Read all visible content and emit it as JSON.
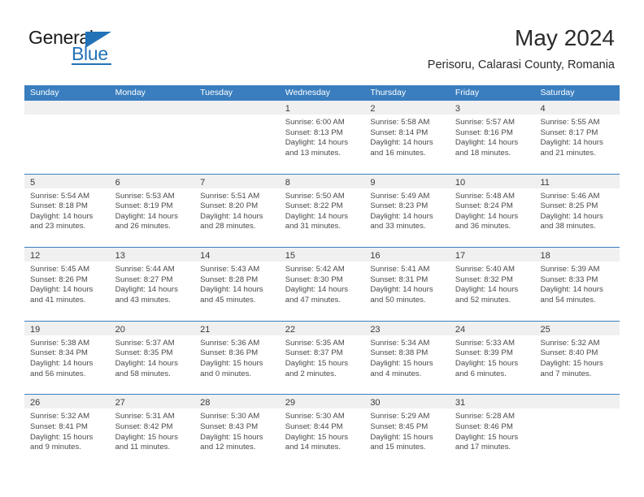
{
  "brand": {
    "name_part1": "General",
    "name_part2": "Blue",
    "accent_color": "#2272b8"
  },
  "header": {
    "month_year": "May 2024",
    "location": "Perisoru, Calarasi County, Romania"
  },
  "calendar": {
    "header_bg": "#3a7ebf",
    "day_band_bg": "#f0f0f0",
    "weekday_headers": [
      "Sunday",
      "Monday",
      "Tuesday",
      "Wednesday",
      "Thursday",
      "Friday",
      "Saturday"
    ],
    "weeks": [
      [
        {
          "day": "",
          "lines": []
        },
        {
          "day": "",
          "lines": []
        },
        {
          "day": "",
          "lines": []
        },
        {
          "day": "1",
          "lines": [
            "Sunrise: 6:00 AM",
            "Sunset: 8:13 PM",
            "Daylight: 14 hours",
            "and 13 minutes."
          ]
        },
        {
          "day": "2",
          "lines": [
            "Sunrise: 5:58 AM",
            "Sunset: 8:14 PM",
            "Daylight: 14 hours",
            "and 16 minutes."
          ]
        },
        {
          "day": "3",
          "lines": [
            "Sunrise: 5:57 AM",
            "Sunset: 8:16 PM",
            "Daylight: 14 hours",
            "and 18 minutes."
          ]
        },
        {
          "day": "4",
          "lines": [
            "Sunrise: 5:55 AM",
            "Sunset: 8:17 PM",
            "Daylight: 14 hours",
            "and 21 minutes."
          ]
        }
      ],
      [
        {
          "day": "5",
          "lines": [
            "Sunrise: 5:54 AM",
            "Sunset: 8:18 PM",
            "Daylight: 14 hours",
            "and 23 minutes."
          ]
        },
        {
          "day": "6",
          "lines": [
            "Sunrise: 5:53 AM",
            "Sunset: 8:19 PM",
            "Daylight: 14 hours",
            "and 26 minutes."
          ]
        },
        {
          "day": "7",
          "lines": [
            "Sunrise: 5:51 AM",
            "Sunset: 8:20 PM",
            "Daylight: 14 hours",
            "and 28 minutes."
          ]
        },
        {
          "day": "8",
          "lines": [
            "Sunrise: 5:50 AM",
            "Sunset: 8:22 PM",
            "Daylight: 14 hours",
            "and 31 minutes."
          ]
        },
        {
          "day": "9",
          "lines": [
            "Sunrise: 5:49 AM",
            "Sunset: 8:23 PM",
            "Daylight: 14 hours",
            "and 33 minutes."
          ]
        },
        {
          "day": "10",
          "lines": [
            "Sunrise: 5:48 AM",
            "Sunset: 8:24 PM",
            "Daylight: 14 hours",
            "and 36 minutes."
          ]
        },
        {
          "day": "11",
          "lines": [
            "Sunrise: 5:46 AM",
            "Sunset: 8:25 PM",
            "Daylight: 14 hours",
            "and 38 minutes."
          ]
        }
      ],
      [
        {
          "day": "12",
          "lines": [
            "Sunrise: 5:45 AM",
            "Sunset: 8:26 PM",
            "Daylight: 14 hours",
            "and 41 minutes."
          ]
        },
        {
          "day": "13",
          "lines": [
            "Sunrise: 5:44 AM",
            "Sunset: 8:27 PM",
            "Daylight: 14 hours",
            "and 43 minutes."
          ]
        },
        {
          "day": "14",
          "lines": [
            "Sunrise: 5:43 AM",
            "Sunset: 8:28 PM",
            "Daylight: 14 hours",
            "and 45 minutes."
          ]
        },
        {
          "day": "15",
          "lines": [
            "Sunrise: 5:42 AM",
            "Sunset: 8:30 PM",
            "Daylight: 14 hours",
            "and 47 minutes."
          ]
        },
        {
          "day": "16",
          "lines": [
            "Sunrise: 5:41 AM",
            "Sunset: 8:31 PM",
            "Daylight: 14 hours",
            "and 50 minutes."
          ]
        },
        {
          "day": "17",
          "lines": [
            "Sunrise: 5:40 AM",
            "Sunset: 8:32 PM",
            "Daylight: 14 hours",
            "and 52 minutes."
          ]
        },
        {
          "day": "18",
          "lines": [
            "Sunrise: 5:39 AM",
            "Sunset: 8:33 PM",
            "Daylight: 14 hours",
            "and 54 minutes."
          ]
        }
      ],
      [
        {
          "day": "19",
          "lines": [
            "Sunrise: 5:38 AM",
            "Sunset: 8:34 PM",
            "Daylight: 14 hours",
            "and 56 minutes."
          ]
        },
        {
          "day": "20",
          "lines": [
            "Sunrise: 5:37 AM",
            "Sunset: 8:35 PM",
            "Daylight: 14 hours",
            "and 58 minutes."
          ]
        },
        {
          "day": "21",
          "lines": [
            "Sunrise: 5:36 AM",
            "Sunset: 8:36 PM",
            "Daylight: 15 hours",
            "and 0 minutes."
          ]
        },
        {
          "day": "22",
          "lines": [
            "Sunrise: 5:35 AM",
            "Sunset: 8:37 PM",
            "Daylight: 15 hours",
            "and 2 minutes."
          ]
        },
        {
          "day": "23",
          "lines": [
            "Sunrise: 5:34 AM",
            "Sunset: 8:38 PM",
            "Daylight: 15 hours",
            "and 4 minutes."
          ]
        },
        {
          "day": "24",
          "lines": [
            "Sunrise: 5:33 AM",
            "Sunset: 8:39 PM",
            "Daylight: 15 hours",
            "and 6 minutes."
          ]
        },
        {
          "day": "25",
          "lines": [
            "Sunrise: 5:32 AM",
            "Sunset: 8:40 PM",
            "Daylight: 15 hours",
            "and 7 minutes."
          ]
        }
      ],
      [
        {
          "day": "26",
          "lines": [
            "Sunrise: 5:32 AM",
            "Sunset: 8:41 PM",
            "Daylight: 15 hours",
            "and 9 minutes."
          ]
        },
        {
          "day": "27",
          "lines": [
            "Sunrise: 5:31 AM",
            "Sunset: 8:42 PM",
            "Daylight: 15 hours",
            "and 11 minutes."
          ]
        },
        {
          "day": "28",
          "lines": [
            "Sunrise: 5:30 AM",
            "Sunset: 8:43 PM",
            "Daylight: 15 hours",
            "and 12 minutes."
          ]
        },
        {
          "day": "29",
          "lines": [
            "Sunrise: 5:30 AM",
            "Sunset: 8:44 PM",
            "Daylight: 15 hours",
            "and 14 minutes."
          ]
        },
        {
          "day": "30",
          "lines": [
            "Sunrise: 5:29 AM",
            "Sunset: 8:45 PM",
            "Daylight: 15 hours",
            "and 15 minutes."
          ]
        },
        {
          "day": "31",
          "lines": [
            "Sunrise: 5:28 AM",
            "Sunset: 8:46 PM",
            "Daylight: 15 hours",
            "and 17 minutes."
          ]
        },
        {
          "day": "",
          "lines": []
        }
      ]
    ]
  }
}
